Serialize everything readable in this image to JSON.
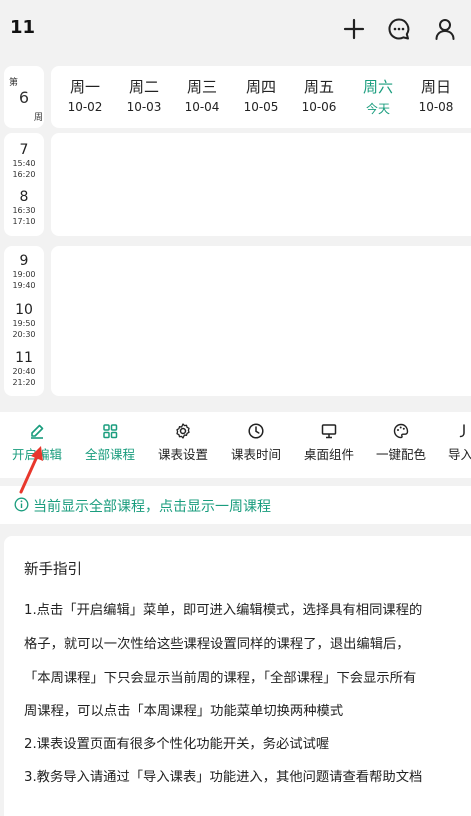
{
  "header": {
    "title": "11"
  },
  "week": {
    "di": "第",
    "num": "6",
    "zhou": "周"
  },
  "days": [
    {
      "wk": "周一",
      "dt": "10-02"
    },
    {
      "wk": "周二",
      "dt": "10-03"
    },
    {
      "wk": "周三",
      "dt": "10-04"
    },
    {
      "wk": "周四",
      "dt": "10-05"
    },
    {
      "wk": "周五",
      "dt": "10-06"
    },
    {
      "wk": "周六",
      "dt": "今天"
    },
    {
      "wk": "周日",
      "dt": "10-08"
    }
  ],
  "slots": [
    {
      "n": "7",
      "s": "15:40",
      "e": "16:20"
    },
    {
      "n": "8",
      "s": "16:30",
      "e": "17:10"
    },
    {
      "n": "9",
      "s": "19:00",
      "e": "19:40"
    },
    {
      "n": "10",
      "s": "19:50",
      "e": "20:30"
    },
    {
      "n": "11",
      "s": "20:40",
      "e": "21:20"
    }
  ],
  "toolbar": [
    {
      "label": "开启编辑",
      "icon": "edit-icon"
    },
    {
      "label": "全部课程",
      "icon": "grid-icon"
    },
    {
      "label": "课表设置",
      "icon": "gear-icon"
    },
    {
      "label": "课表时间",
      "icon": "clock-icon"
    },
    {
      "label": "桌面组件",
      "icon": "monitor-icon"
    },
    {
      "label": "一键配色",
      "icon": "palette-icon"
    },
    {
      "label": "导入",
      "icon": "import-icon"
    }
  ],
  "notice": {
    "text": "当前显示全部课程，点击显示一周课程"
  },
  "guide": {
    "title": "新手指引",
    "lines": [
      "1.点击「开启编辑」菜单，即可进入编辑模式，选择具有相同课程的",
      "格子，就可以一次性给这些课程设置同样的课程了，退出编辑后，",
      "「本周课程」下只会显示当前周的课程，「全部课程」下会显示所有",
      "周课程，可以点击「本周课程」功能菜单切换两种模式",
      "2.课表设置页面有很多个性化功能开关，务必试试喔",
      "3.教务导入请通过「导入课表」功能进入，其他问题请查看帮助文档"
    ]
  },
  "colors": {
    "accent": "#1a9d7e",
    "arrow": "#e8372c"
  }
}
